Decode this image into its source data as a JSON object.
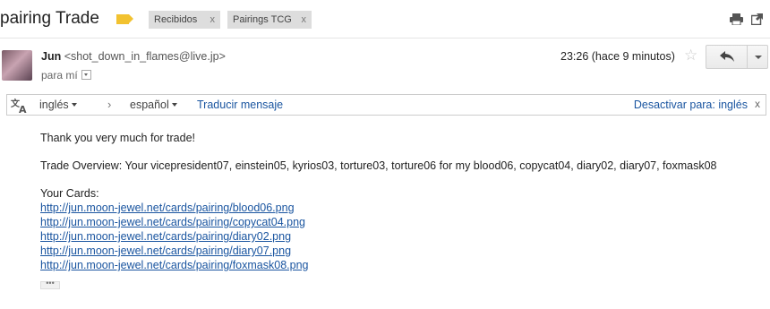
{
  "header": {
    "subject": "pairing Trade",
    "labels": [
      {
        "name": "Recibidos",
        "close": "x"
      },
      {
        "name": "Pairings TCG",
        "close": "x"
      }
    ],
    "icons": {
      "label": "label-icon",
      "print": "print-icon",
      "popout": "new-window-icon"
    }
  },
  "message": {
    "sender_name": "Jun",
    "sender_email": "<shot_down_in_flames@live.jp>",
    "to_line": "para mí",
    "timestamp": "23:26 (hace 9 minutos)",
    "star": "☆"
  },
  "translate_bar": {
    "from_lang": "inglés",
    "chevron": "›",
    "to_lang": "español",
    "translate_link": "Traducir mensaje",
    "disable_link": "Desactivar para: inglés",
    "close": "x"
  },
  "body": {
    "greeting": "Thank you very much for trade!",
    "overview": "Trade Overview: Your vicepresident07, einstein05, kyrios03, torture03, torture06 for my blood06, copycat04, diary02, diary07, foxmask08",
    "cards_heading": "Your Cards:",
    "card_links": [
      "http://jun.moon-jewel.net/cards/pairing/blood06.png",
      "http://jun.moon-jewel.net/cards/pairing/copycat04.png",
      "http://jun.moon-jewel.net/cards/pairing/diary02.png",
      "http://jun.moon-jewel.net/cards/pairing/diary07.png",
      "http://jun.moon-jewel.net/cards/pairing/foxmask08.png"
    ],
    "ellipsis": "•••"
  },
  "colors": {
    "link": "#1a55a0",
    "label_tag": "#f2c230",
    "chip_bg": "#dddddd"
  }
}
